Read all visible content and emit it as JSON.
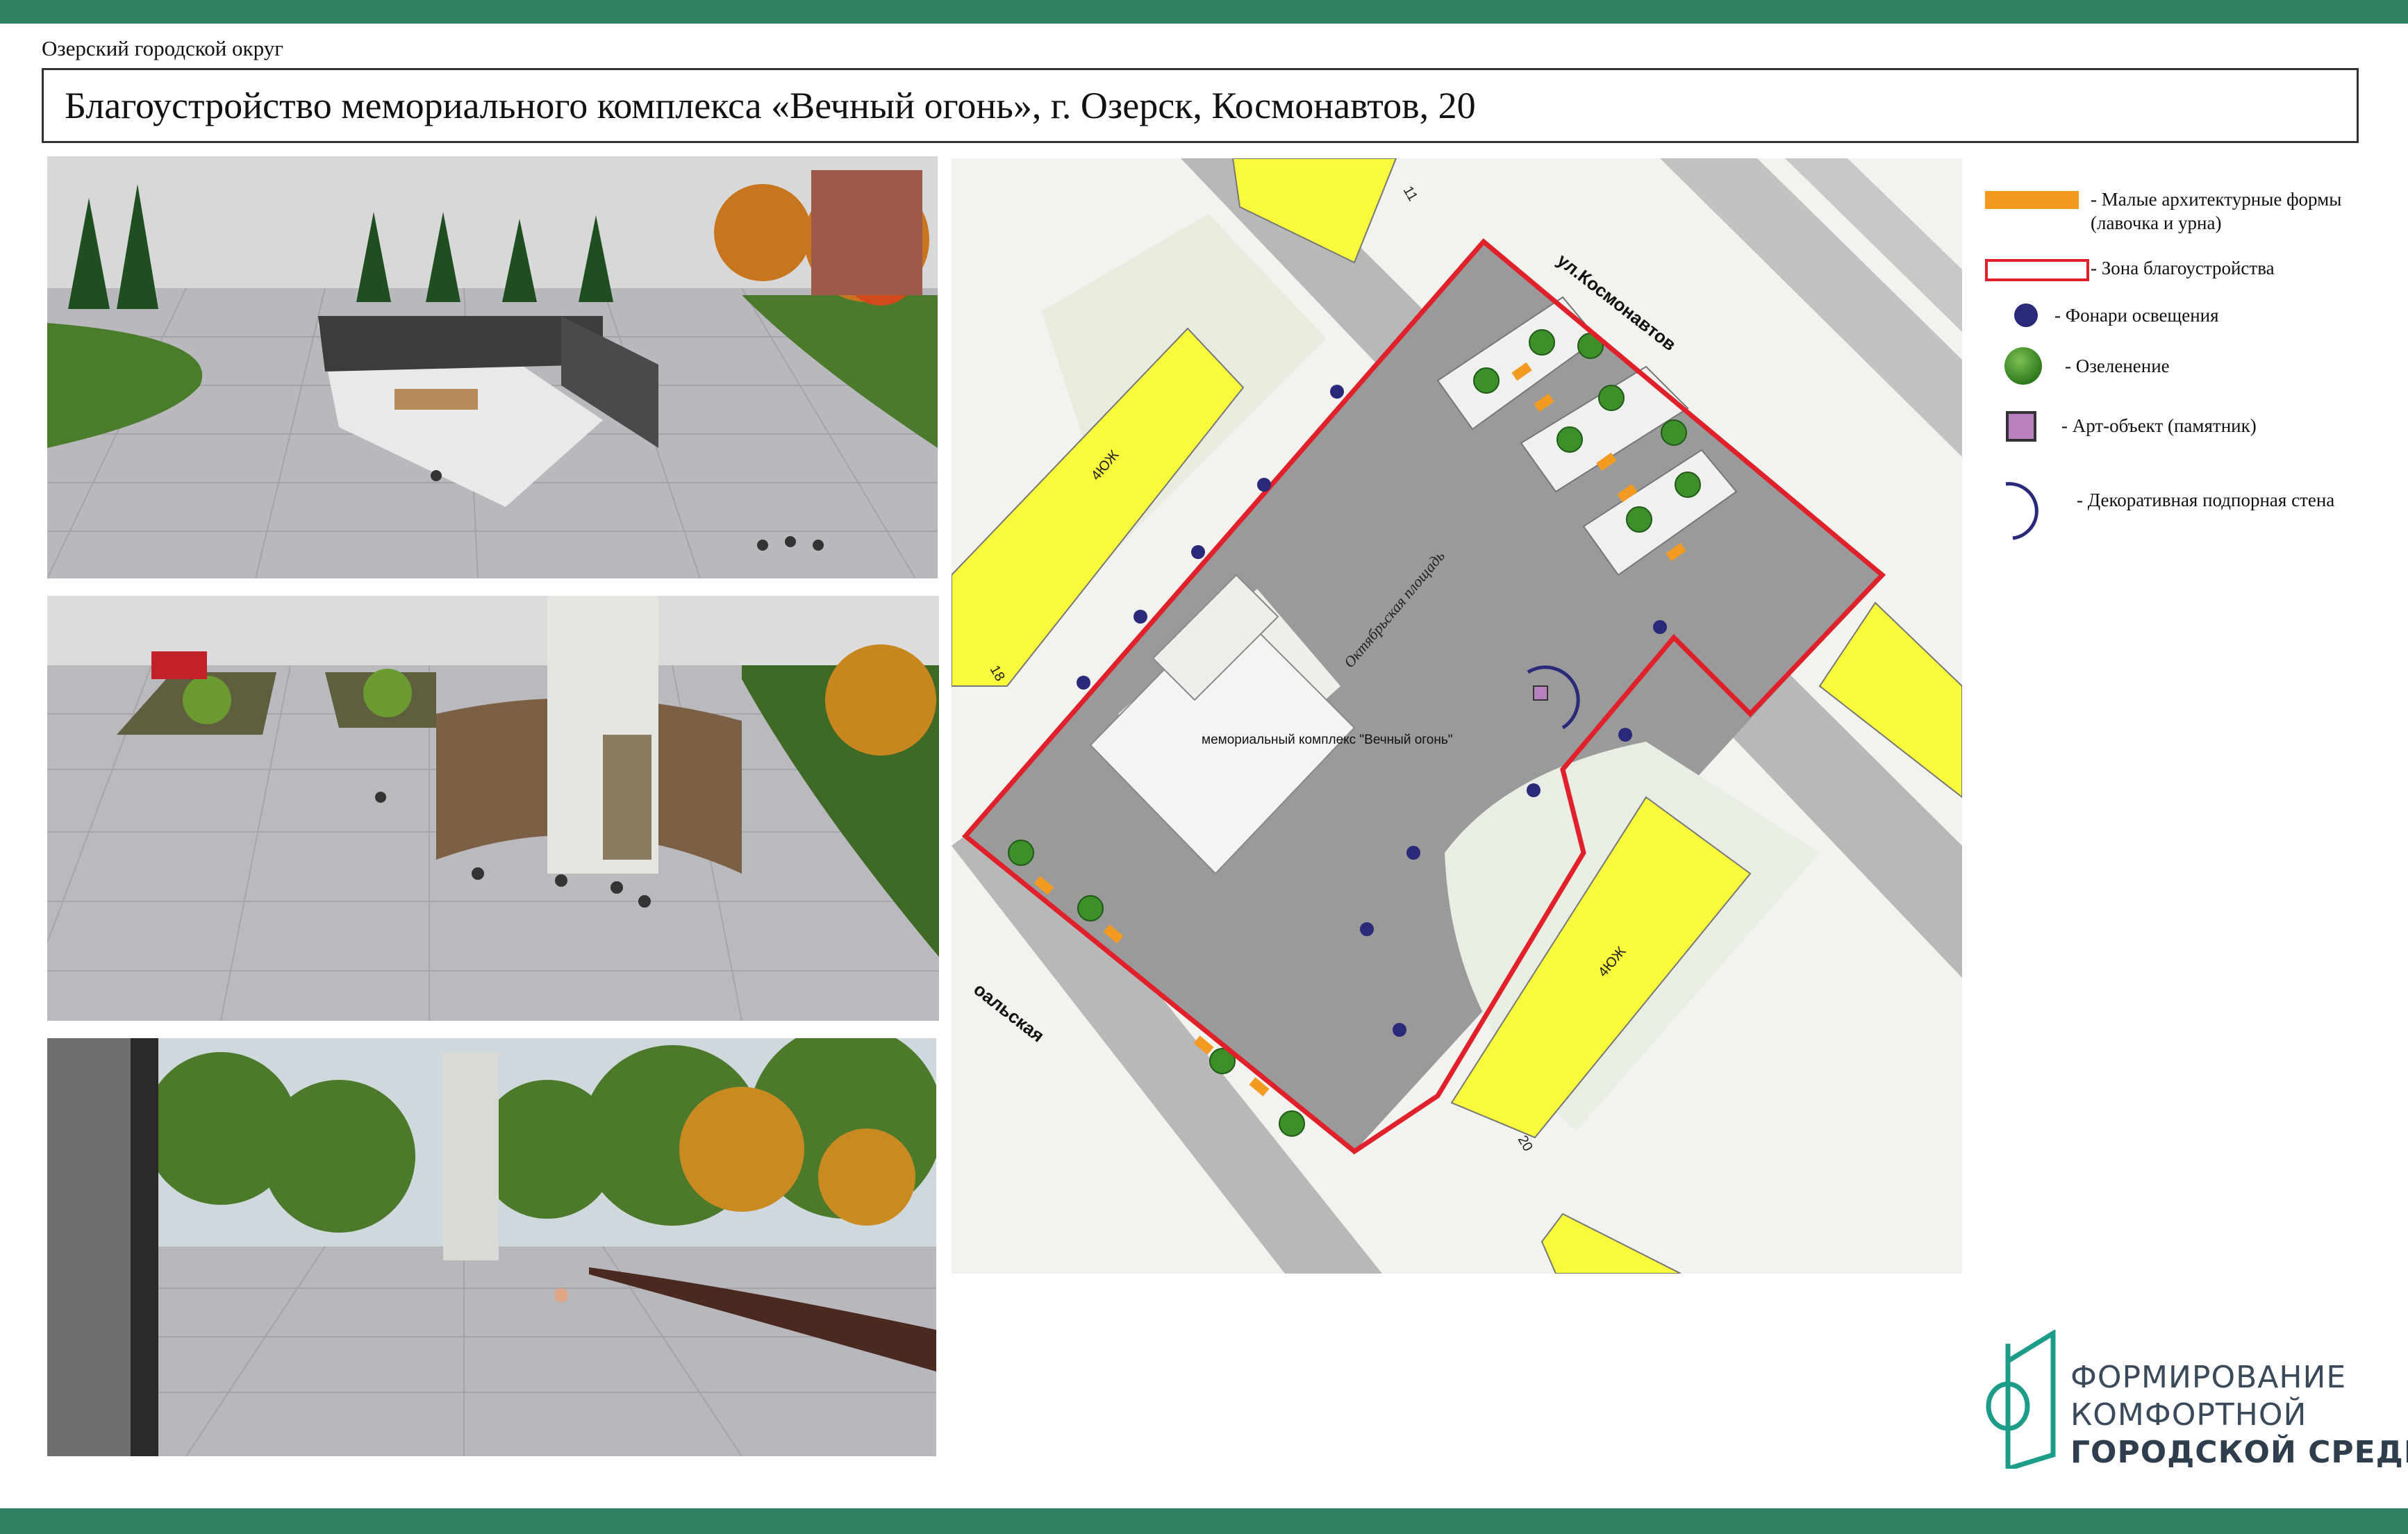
{
  "header": {
    "district": "Озерский городской округ",
    "title": "Благоустройство мемориального комплекса «Вечный огонь», г. Озерск, Космонавтов, 20"
  },
  "map": {
    "street_kosmonavtov": "ул.Космонавтов",
    "street_partial": "оальская",
    "square_name": "Октябрьская площадь",
    "memorial_label": "мемориальный комплекс \"Вечный огонь\"",
    "building_label_1": "4ЮЖ",
    "building_label_2": "4ЮЖ",
    "house_11": "11",
    "house_18": "18",
    "house_20": "20"
  },
  "legend": {
    "items": [
      {
        "label_1": "- Малые архитектурные формы",
        "label_2": "(лавочка и урна)",
        "icon": "orange-bar-icon",
        "color": "#f39a21"
      },
      {
        "label_1": "- Зона благоустройства",
        "icon": "red-outline-icon",
        "color": "#e0202a"
      },
      {
        "label_1": "- Фонари освещения",
        "icon": "lamp-dot-icon",
        "color": "#2b2a7a"
      },
      {
        "label_1": "- Озеленение",
        "icon": "tree-icon",
        "color": "#3d8f2a"
      },
      {
        "label_1": "- Арт-объект (памятник)",
        "icon": "monument-square-icon",
        "color": "#b980c0"
      },
      {
        "label_1": "- Декоративная подпорная стена",
        "icon": "arc-wall-icon",
        "color": "#2b2a7a"
      }
    ]
  },
  "logo": {
    "line1": "ФОРМИРОВАНИЕ",
    "line2": "КОМФОРТНОЙ",
    "line3": "ГОРОДСКОЙ СРЕДЫ",
    "color": "#1e9c8a"
  },
  "colors": {
    "frame_bar": "#2e8262",
    "zone_outline": "#e0202a",
    "residential": "#fbfb3a"
  }
}
